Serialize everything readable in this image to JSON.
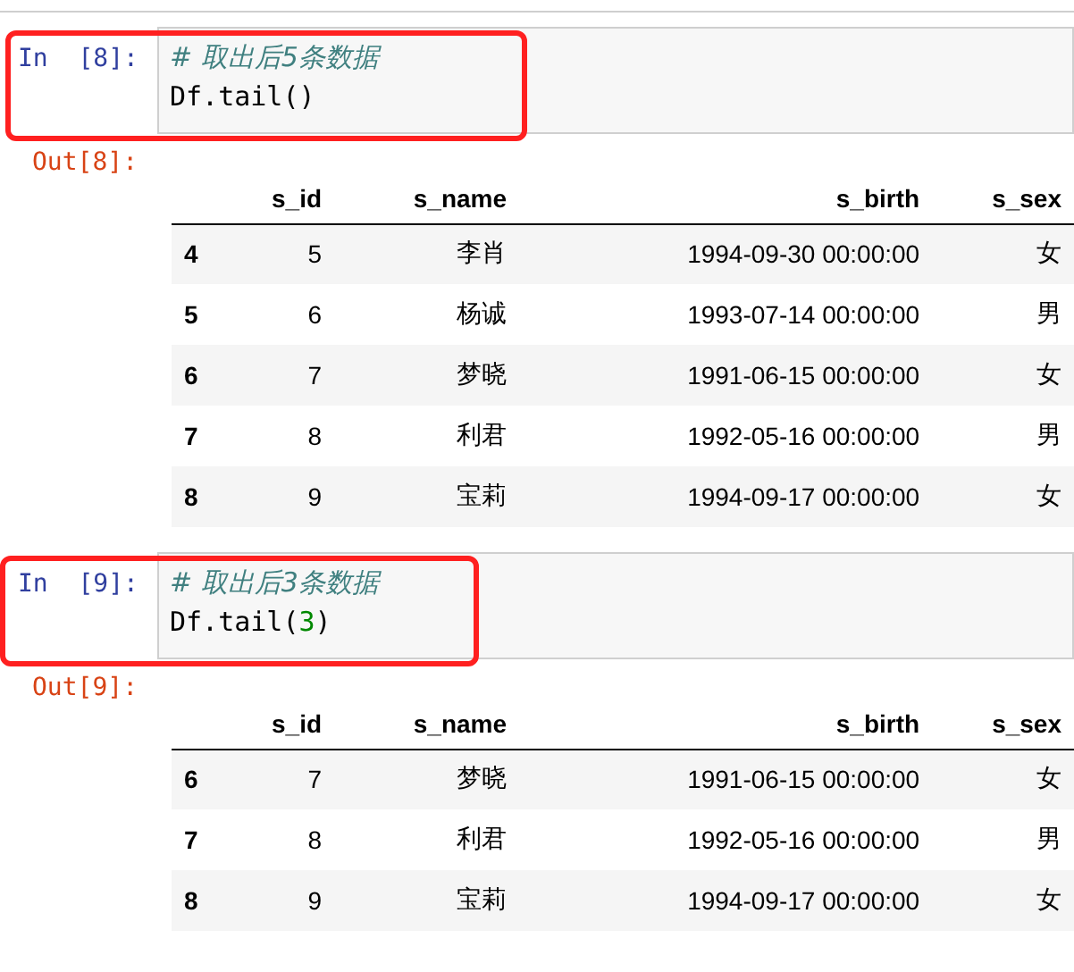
{
  "cells": [
    {
      "in_prompt": "In  [8]:",
      "highlighted": true,
      "code": [
        [
          {
            "kind": "comment",
            "text": "# 取出后5条数据"
          }
        ],
        [
          {
            "kind": "plain",
            "text": "Df.tail()"
          }
        ]
      ],
      "out_prompt": "Out[8]:",
      "table": {
        "columns": [
          "",
          "s_id",
          "s_name",
          "s_birth",
          "s_sex"
        ],
        "rows": [
          [
            "4",
            "5",
            "李肖",
            "1994-09-30 00:00:00",
            "女"
          ],
          [
            "5",
            "6",
            "杨诚",
            "1993-07-14 00:00:00",
            "男"
          ],
          [
            "6",
            "7",
            "梦晓",
            "1991-06-15 00:00:00",
            "女"
          ],
          [
            "7",
            "8",
            "利君",
            "1992-05-16 00:00:00",
            "男"
          ],
          [
            "8",
            "9",
            "宝莉",
            "1994-09-17 00:00:00",
            "女"
          ]
        ]
      }
    },
    {
      "in_prompt": "In  [9]:",
      "highlighted": true,
      "code": [
        [
          {
            "kind": "comment",
            "text": "# 取出后3条数据"
          }
        ],
        [
          {
            "kind": "plain",
            "text": "Df.tail("
          },
          {
            "kind": "number",
            "text": "3"
          },
          {
            "kind": "plain",
            "text": ")"
          }
        ]
      ],
      "out_prompt": "Out[9]:",
      "table": {
        "columns": [
          "",
          "s_id",
          "s_name",
          "s_birth",
          "s_sex"
        ],
        "rows": [
          [
            "6",
            "7",
            "梦晓",
            "1991-06-15 00:00:00",
            "女"
          ],
          [
            "7",
            "8",
            "利君",
            "1992-05-16 00:00:00",
            "男"
          ],
          [
            "8",
            "9",
            "宝莉",
            "1994-09-17 00:00:00",
            "女"
          ]
        ]
      }
    }
  ]
}
